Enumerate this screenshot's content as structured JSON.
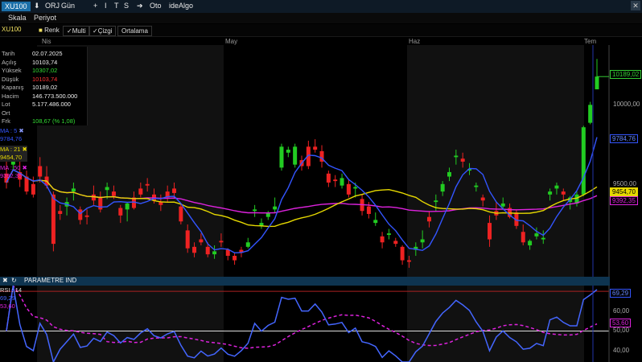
{
  "toolbar": {
    "symbol": "XU100",
    "items": [
      "ORJ",
      "Gün",
      "+",
      "I",
      "T",
      "S",
      "Oto",
      "ideAlgo"
    ],
    "close": "✕"
  },
  "menu": {
    "scale": "Skala",
    "period": "Periyot"
  },
  "tabs": {
    "symbol": "XU100",
    "color": "Renk",
    "multi": "Multi",
    "line": "Çizgi",
    "average": "Ortalama"
  },
  "months": [
    "Nis",
    "May",
    "Haz",
    "Tem"
  ],
  "info": {
    "rows": [
      {
        "k": "Tarih",
        "v": "02.07.2025",
        "color": "#eeeeee"
      },
      {
        "k": "Açılış",
        "v": "10103,74",
        "color": "#eeeeee"
      },
      {
        "k": "Yüksek",
        "v": "10307,02",
        "color": "#33dd33"
      },
      {
        "k": "Düşük",
        "v": "10103,74",
        "color": "#ff3333"
      },
      {
        "k": "Kapanış",
        "v": "10189,02",
        "color": "#eeeeee"
      },
      {
        "k": "Hacim",
        "v": "146.773.500.000",
        "color": "#eeeeee"
      },
      {
        "k": "Lot",
        "v": "5.177.486.000",
        "color": "#eeeeee"
      },
      {
        "k": "Ort",
        "v": "",
        "color": "#eeeeee"
      },
      {
        "k": "Frk",
        "v": "108,67 (% 1,08)",
        "color": "#33dd33"
      }
    ]
  },
  "ma": {
    "ma5": {
      "label": "MA : 5",
      "value": "9784,76",
      "color": "#3355ff"
    },
    "ma21": {
      "label": "MA : 21",
      "value": "9454,70",
      "color": "#e6d800"
    },
    "ma50": {
      "label": "MA : 50",
      "value": "9392,35",
      "color": "#dd22dd"
    }
  },
  "price_axis": {
    "labels": [
      "10000,00",
      "9500,00"
    ]
  },
  "price_tags": {
    "last": {
      "text": "10189,02",
      "color": "#33cc33"
    },
    "ma5": {
      "text": "9784,76",
      "color": "#3355ff"
    },
    "ma21": {
      "text": "9454,70",
      "color": "#e6d800"
    },
    "ma50": {
      "text": "9392,35",
      "color": "#dd22dd"
    }
  },
  "rsi_panel": {
    "header": "PARAMETRE   IND",
    "label": "RSI : 14",
    "rsi_value": "69,29",
    "avg_value": "53,60",
    "axis": [
      "60,00",
      "50,00",
      "40,00"
    ],
    "tag_rsi": "69,29",
    "tag_avg": "53,60"
  },
  "chart_data": {
    "type": "candlestick",
    "x_months": [
      "Nis",
      "May",
      "Haz",
      "Tem"
    ],
    "ylim": [
      8850,
      10400
    ],
    "last_close": 10189.02,
    "candles": [
      [
        9540,
        9620,
        9440,
        9480
      ],
      [
        9600,
        9700,
        9560,
        9650
      ],
      [
        9550,
        9620,
        9450,
        9500
      ],
      [
        9520,
        9560,
        9400,
        9420
      ],
      [
        9470,
        9520,
        9380,
        9400
      ],
      [
        9590,
        9650,
        9480,
        9520
      ],
      [
        9520,
        9590,
        9440,
        9460
      ],
      [
        9400,
        9420,
        9020,
        9070
      ],
      [
        9290,
        9330,
        9230,
        9270
      ],
      [
        9320,
        9380,
        9260,
        9350
      ],
      [
        9420,
        9480,
        9360,
        9440
      ],
      [
        9300,
        9320,
        9200,
        9230
      ],
      [
        9260,
        9300,
        9200,
        9250
      ],
      [
        9400,
        9460,
        9330,
        9360
      ],
      [
        9380,
        9420,
        9280,
        9300
      ],
      [
        9430,
        9480,
        9370,
        9450
      ],
      [
        9420,
        9460,
        9370,
        9390
      ],
      [
        9310,
        9330,
        9210,
        9260
      ],
      [
        9300,
        9350,
        9220,
        9340
      ],
      [
        9380,
        9420,
        9300,
        9310
      ],
      [
        9440,
        9480,
        9380,
        9400
      ],
      [
        9470,
        9510,
        9420,
        9460
      ],
      [
        9400,
        9440,
        9340,
        9360
      ],
      [
        9350,
        9400,
        9290,
        9330
      ],
      [
        9420,
        9460,
        9350,
        9380
      ],
      [
        9440,
        9480,
        9380,
        9410
      ],
      [
        9320,
        9340,
        9200,
        9220
      ],
      [
        9160,
        9200,
        9010,
        9040
      ],
      [
        9050,
        9080,
        8980,
        9010
      ],
      [
        9100,
        9140,
        9060,
        9080
      ],
      [
        9050,
        9080,
        8980,
        9000
      ],
      [
        9000,
        9060,
        8970,
        9020
      ],
      [
        9090,
        9140,
        9050,
        9080
      ],
      [
        9030,
        9040,
        8960,
        8990
      ],
      [
        8990,
        9010,
        8930,
        8960
      ],
      [
        9030,
        9050,
        8980,
        9010
      ],
      [
        9050,
        9110,
        9040,
        9080
      ],
      [
        9290,
        9330,
        9250,
        9300
      ],
      [
        9190,
        9240,
        9170,
        9210
      ],
      [
        9250,
        9290,
        9230,
        9280
      ],
      [
        9300,
        9380,
        9280,
        9320
      ],
      [
        9580,
        9740,
        9560,
        9720
      ],
      [
        9680,
        9720,
        9650,
        9700
      ],
      [
        9600,
        9740,
        9580,
        9720
      ],
      [
        9630,
        9660,
        9560,
        9590
      ],
      [
        9720,
        9760,
        9570,
        9590
      ],
      [
        9720,
        9770,
        9680,
        9700
      ],
      [
        9690,
        9730,
        9580,
        9620
      ],
      [
        9540,
        9560,
        9450,
        9480
      ],
      [
        9500,
        9530,
        9450,
        9490
      ],
      [
        9460,
        9540,
        9440,
        9510
      ],
      [
        9470,
        9500,
        9380,
        9400
      ],
      [
        9440,
        9480,
        9380,
        9450
      ],
      [
        9370,
        9400,
        9260,
        9290
      ],
      [
        9320,
        9350,
        9240,
        9270
      ],
      [
        9210,
        9280,
        9190,
        9230
      ],
      [
        9120,
        9150,
        9040,
        9080
      ],
      [
        9130,
        9170,
        9100,
        9140
      ],
      [
        9090,
        9110,
        9050,
        9070
      ],
      [
        9050,
        9060,
        8930,
        8960
      ],
      [
        8960,
        8990,
        8910,
        8950
      ],
      [
        9030,
        9080,
        8990,
        9050
      ],
      [
        9080,
        9160,
        9040,
        9100
      ],
      [
        9250,
        9290,
        9180,
        9220
      ],
      [
        9350,
        9400,
        9290,
        9360
      ],
      [
        9420,
        9490,
        9390,
        9470
      ],
      [
        9520,
        9580,
        9490,
        9550
      ],
      [
        9650,
        9700,
        9600,
        9660
      ],
      [
        9640,
        9680,
        9580,
        9620
      ],
      [
        9560,
        9610,
        9530,
        9570
      ],
      [
        9450,
        9480,
        9420,
        9460
      ],
      [
        9380,
        9400,
        9320,
        9360
      ],
      [
        9210,
        9260,
        9050,
        9100
      ],
      [
        9290,
        9350,
        9230,
        9260
      ],
      [
        9320,
        9380,
        9300,
        9340
      ],
      [
        9310,
        9340,
        9240,
        9250
      ],
      [
        9280,
        9300,
        9170,
        9190
      ],
      [
        9150,
        9200,
        9060,
        9080
      ],
      [
        9060,
        9100,
        9030,
        9090
      ],
      [
        9120,
        9180,
        9100,
        9140
      ],
      [
        9100,
        9160,
        9070,
        9110
      ],
      [
        9400,
        9440,
        9360,
        9420
      ],
      [
        9440,
        9480,
        9400,
        9460
      ],
      [
        9420,
        9440,
        9360,
        9400
      ],
      [
        9350,
        9390,
        9300,
        9380
      ],
      [
        9340,
        9420,
        9320,
        9400
      ],
      [
        9400,
        9860,
        9390,
        9850
      ],
      [
        9880,
        10020,
        9870,
        10000
      ],
      [
        10103.74,
        10307.02,
        10103.74,
        10189.02
      ]
    ],
    "ma5_end": 9784.76,
    "ma21_end": 9454.7,
    "ma50_end": 9392.35,
    "rsi": {
      "ylim": [
        35,
        72
      ],
      "rsi_last": 69.29,
      "avg_last": 53.6,
      "levels": [
        60,
        50,
        40
      ]
    }
  },
  "colors": {
    "up": "#22cc22",
    "down": "#ee2222",
    "ma5": "#3355ff",
    "ma21": "#e6d800",
    "ma50": "#dd22dd",
    "rsi": "#4466ff",
    "rsi_avg": "#dd22dd"
  }
}
